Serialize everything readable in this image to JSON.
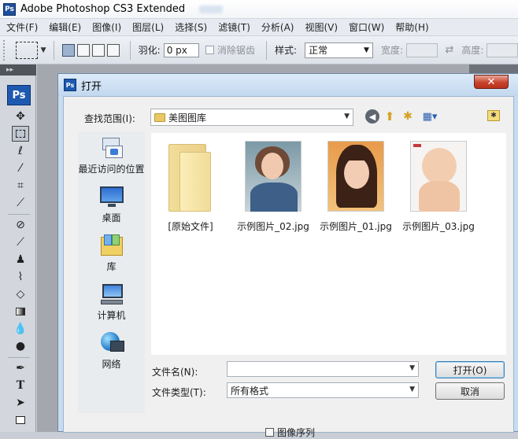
{
  "app": {
    "logo": "Ps",
    "title": "Adobe Photoshop CS3 Extended"
  },
  "menubar": {
    "items": [
      "文件(F)",
      "编辑(E)",
      "图像(I)",
      "图层(L)",
      "选择(S)",
      "滤镜(T)",
      "分析(A)",
      "视图(V)",
      "窗口(W)",
      "帮助(H)"
    ]
  },
  "options": {
    "feather_label": "羽化:",
    "feather_value": "0 px",
    "antialias_label": "消除锯齿",
    "style_label": "样式:",
    "style_value": "正常",
    "width_label": "宽度:",
    "height_label": "高度:",
    "swap_icon": "⇄"
  },
  "toolbox": {
    "badge": "Ps",
    "collapse": "▸▸"
  },
  "dialog": {
    "title": "打开",
    "close": "✕",
    "lookin_label": "查找范围(I):",
    "lookin_value": "美图图库",
    "places": [
      {
        "label": "最近访问的位置",
        "icon": "recent-places-icon"
      },
      {
        "label": "桌面",
        "icon": "desktop-icon"
      },
      {
        "label": "库",
        "icon": "libraries-icon"
      },
      {
        "label": "计算机",
        "icon": "computer-icon"
      },
      {
        "label": "网络",
        "icon": "network-icon"
      }
    ],
    "files": [
      {
        "name": "[原始文件]",
        "type": "folder"
      },
      {
        "name": "示例图片_02.jpg",
        "type": "photo-woman"
      },
      {
        "name": "示例图片_01.jpg",
        "type": "photo-girl"
      },
      {
        "name": "示例图片_03.jpg",
        "type": "photo-baby"
      }
    ],
    "filename_label": "文件名(N):",
    "filename_value": "",
    "filetype_label": "文件类型(T):",
    "filetype_value": "所有格式",
    "open_button": "打开(O)",
    "cancel_button": "取消",
    "preview_label": "图像序列"
  }
}
